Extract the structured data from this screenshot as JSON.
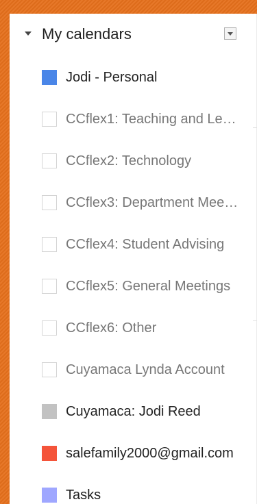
{
  "section": {
    "title": "My calendars"
  },
  "calendars": [
    {
      "label": "Jodi - Personal",
      "color": "#4a86e8",
      "enabled": true
    },
    {
      "label": "CCflex1: Teaching and Learning",
      "color": "",
      "enabled": false
    },
    {
      "label": "CCflex2: Technology",
      "color": "",
      "enabled": false
    },
    {
      "label": "CCflex3: Department Meetings",
      "color": "",
      "enabled": false
    },
    {
      "label": "CCflex4: Student Advising",
      "color": "",
      "enabled": false
    },
    {
      "label": "CCflex5: General Meetings",
      "color": "",
      "enabled": false
    },
    {
      "label": "CCflex6: Other",
      "color": "",
      "enabled": false
    },
    {
      "label": "Cuyamaca Lynda Account",
      "color": "",
      "enabled": false
    },
    {
      "label": "Cuyamaca: Jodi Reed",
      "color": "#c2c2c2",
      "enabled": true
    },
    {
      "label": "salefamily2000@gmail.com",
      "color": "#f4543a",
      "enabled": true
    },
    {
      "label": "Tasks",
      "color": "#9fa7ff",
      "enabled": true
    }
  ],
  "colors": {
    "frame": "#e6701c",
    "panel": "#ffffff"
  },
  "icons": {
    "collapse": "triangle-down-icon",
    "options": "dropdown-menu-icon"
  }
}
